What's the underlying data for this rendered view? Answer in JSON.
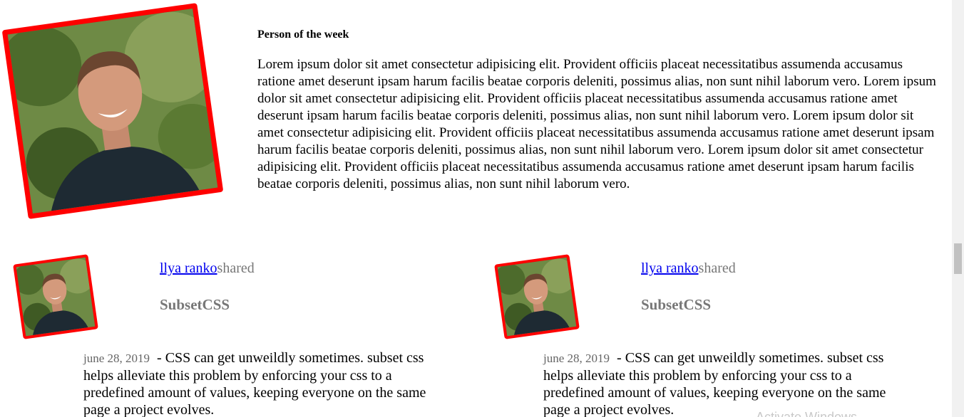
{
  "hero": {
    "title": "Person of the week",
    "text": "Lorem ipsum dolor sit amet consectetur adipisicing elit. Provident officiis placeat necessitatibus assumenda accusamus ratione amet deserunt ipsam harum facilis beatae corporis deleniti, possimus alias, non sunt nihil laborum vero. Lorem ipsum dolor sit amet consectetur adipisicing elit. Provident officiis placeat necessitatibus assumenda accusamus ratione amet deserunt ipsam harum facilis beatae corporis deleniti, possimus alias, non sunt nihil laborum vero. Lorem ipsum dolor sit amet consectetur adipisicing elit. Provident officiis placeat necessitatibus assumenda accusamus ratione amet deserunt ipsam harum facilis beatae corporis deleniti, possimus alias, non sunt nihil laborum vero. Lorem ipsum dolor sit amet consectetur adipisicing elit. Provident officiis placeat necessitatibus assumenda accusamus ratione amet deserunt ipsam harum facilis beatae corporis deleniti, possimus alias, non sunt nihil laborum vero."
  },
  "cards": [
    {
      "author": "llya ranko",
      "action": "shared",
      "title": "SubsetCSS",
      "date": "june 28, 2019",
      "text": "- CSS can get unweildly sometimes. subset css helps alleviate this problem by enforcing your css to a predefined amount of values, keeping everyone on the same page a project evolves."
    },
    {
      "author": "llya ranko",
      "action": "shared",
      "title": "SubsetCSS",
      "date": "june 28, 2019",
      "text": "- CSS can get unweildly sometimes. subset css helps alleviate this problem by enforcing your css to a predefined amount of values, keeping everyone on the same page a project evolves."
    }
  ],
  "watermark": "Activate Windows",
  "colors": {
    "frame": "#ff0000",
    "link": "#0000ee",
    "muted": "#777777"
  }
}
